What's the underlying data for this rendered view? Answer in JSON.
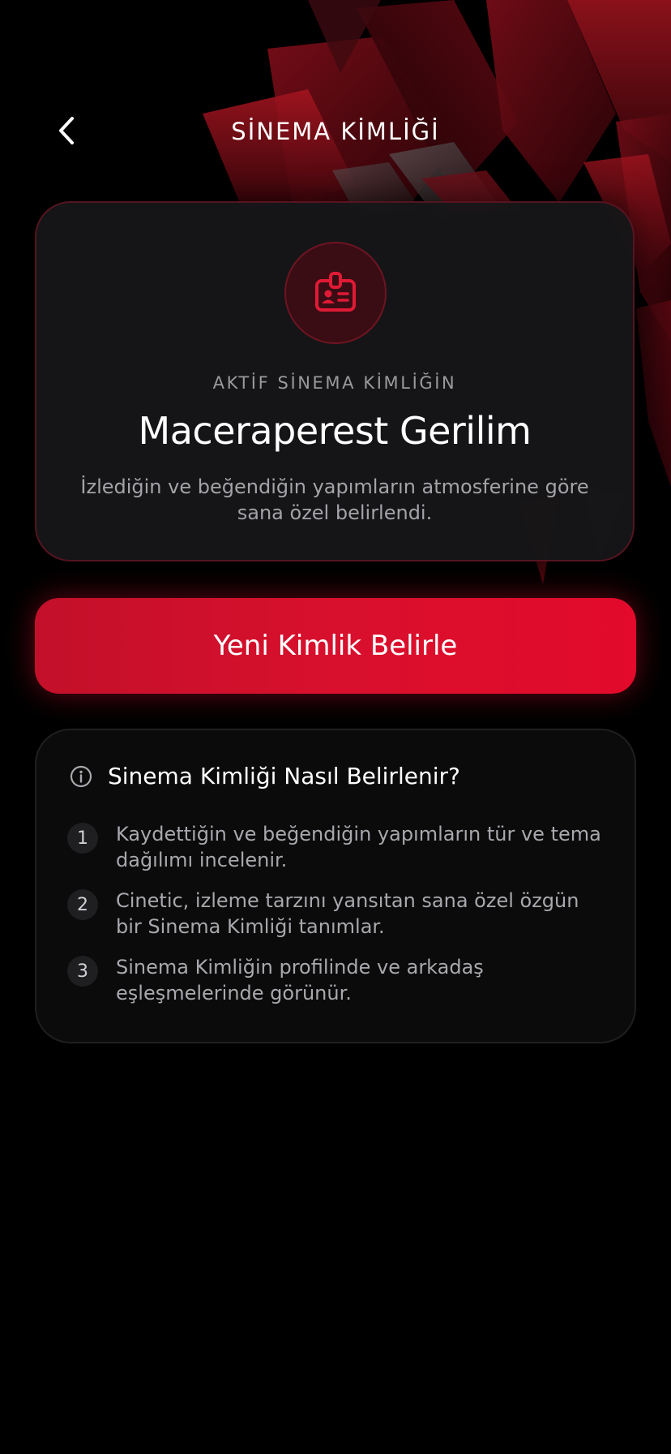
{
  "header": {
    "title": "SİNEMA KİMLİĞİ",
    "back_icon": "chevron-left-icon"
  },
  "identity": {
    "icon": "id-badge-icon",
    "eyebrow": "AKTİF SİNEMA KİMLİĞİN",
    "title": "Maceraperest Gerilim",
    "description": "İzlediğin ve beğendiğin yapımların atmosferine göre sana özel belirlendi."
  },
  "cta": {
    "label": "Yeni Kimlik Belirle"
  },
  "info": {
    "icon": "info-icon",
    "title": "Sinema Kimliği Nasıl Belirlenir?",
    "steps": [
      {
        "number": "1",
        "text": "Kaydettiğin ve beğendiğin yapımların tür ve tema dağılımı incelenir."
      },
      {
        "number": "2",
        "text": "Cinetic, izleme tarzını yansıtan sana özel özgün bir Sinema Kimliği tanımlar."
      },
      {
        "number": "3",
        "text": "Sinema Kimliğin profilinde ve arkadaş eşleşmelerinde görünür."
      }
    ]
  },
  "colors": {
    "background": "#000000",
    "accent": "#D8102D",
    "card": "#161618",
    "muted_text": "#A3A3A8"
  }
}
